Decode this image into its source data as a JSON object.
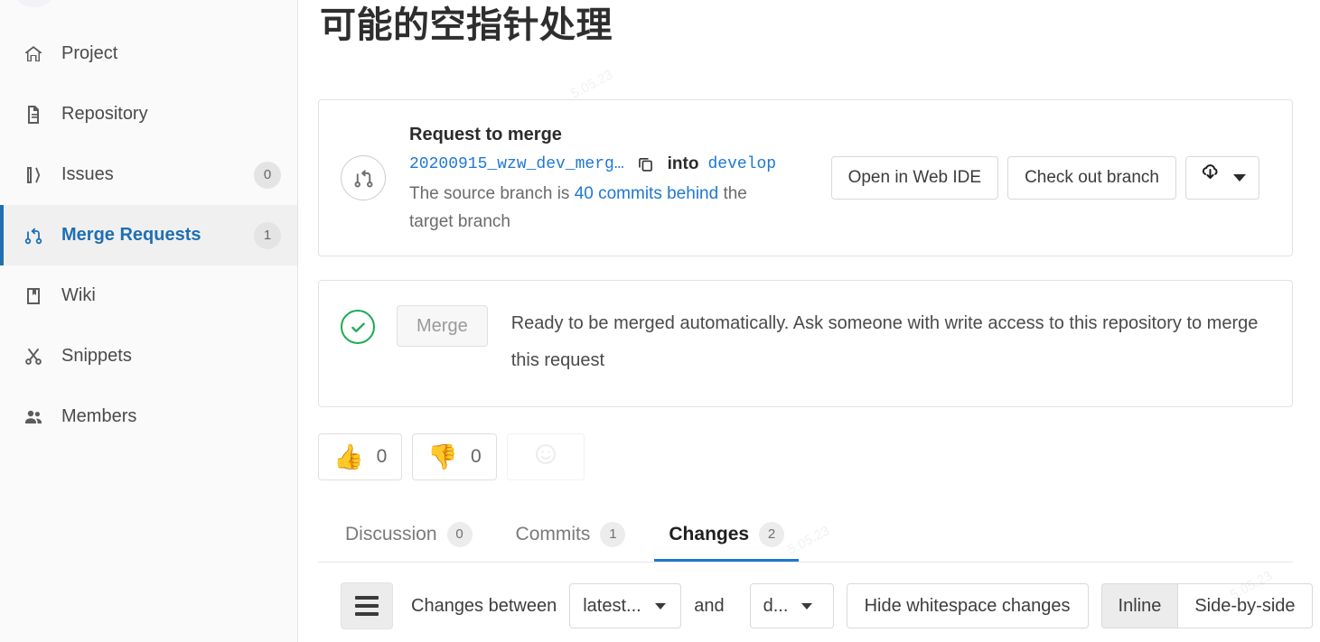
{
  "sidebar": {
    "items": [
      {
        "label": "Project",
        "icon": "home-icon",
        "badge": null,
        "active": false
      },
      {
        "label": "Repository",
        "icon": "document-icon",
        "badge": null,
        "active": false
      },
      {
        "label": "Issues",
        "icon": "issues-icon",
        "badge": "0",
        "active": false
      },
      {
        "label": "Merge Requests",
        "icon": "merge-request-icon",
        "badge": "1",
        "active": true
      },
      {
        "label": "Wiki",
        "icon": "book-icon",
        "badge": null,
        "active": false
      },
      {
        "label": "Snippets",
        "icon": "scissors-icon",
        "badge": null,
        "active": false
      },
      {
        "label": "Members",
        "icon": "people-icon",
        "badge": null,
        "active": false
      }
    ]
  },
  "page": {
    "title": "可能的空指针处理"
  },
  "merge_request": {
    "icon": "merge-request-icon",
    "heading": "Request to merge",
    "source_branch": "20200915_wzw_dev_merg…",
    "copy_icon": "copy-icon",
    "into_word": "into",
    "target_branch": "develop",
    "behind_prefix": "The source branch is ",
    "behind_link": "40 commits behind",
    "behind_suffix": " the target branch",
    "buttons": {
      "web_ide": "Open in Web IDE",
      "checkout": "Check out branch",
      "download_icon": "cloud-download-icon"
    }
  },
  "merge_status": {
    "status_icon": "check-circle-icon",
    "merge_button": "Merge",
    "message": "Ready to be merged automatically. Ask someone with write access to this repository to merge this request",
    "accent_color": "#1aaa55"
  },
  "reactions": [
    {
      "name": "thumbs-up",
      "emoji": "👍",
      "count": "0"
    },
    {
      "name": "thumbs-down",
      "emoji": "👎",
      "count": "0"
    }
  ],
  "reaction_picker_icon": "smiley-icon",
  "tabs": [
    {
      "label": "Discussion",
      "count": "0",
      "active": false
    },
    {
      "label": "Commits",
      "count": "1",
      "active": false
    },
    {
      "label": "Changes",
      "count": "2",
      "active": true
    }
  ],
  "changes_toolbar": {
    "menu_icon": "hamburger-icon",
    "label": "Changes between",
    "source_select": "latest...",
    "and_word": "and",
    "target_select": "d...",
    "whitespace_button": "Hide whitespace changes",
    "view_modes": [
      {
        "label": "Inline",
        "active": true
      },
      {
        "label": "Side-by-side",
        "active": false
      }
    ]
  },
  "theme": {
    "accent_blue": "#1f78d1",
    "success_green": "#1aaa55",
    "sidebar_bg": "#fafafa"
  }
}
